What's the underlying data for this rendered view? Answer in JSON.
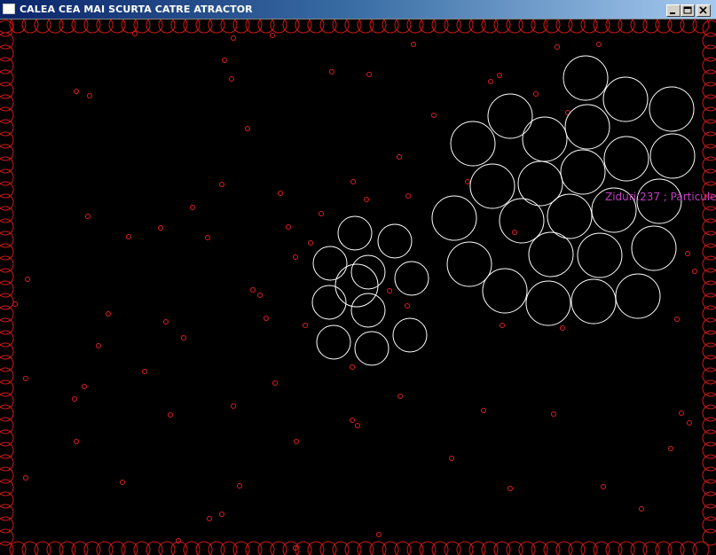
{
  "window": {
    "title": "CALEA CEA MAI SCURTA CATRE ATRACTOR",
    "controls": [
      "minimize",
      "maximize",
      "close"
    ]
  },
  "canvas": {
    "background": "#000000",
    "status_text": "Ziduri:237 ; Particule",
    "status_color": "#c040c0",
    "wall_color": "#d01818",
    "obstacle_color": "#ffffff",
    "particle_color": "#e02020"
  }
}
